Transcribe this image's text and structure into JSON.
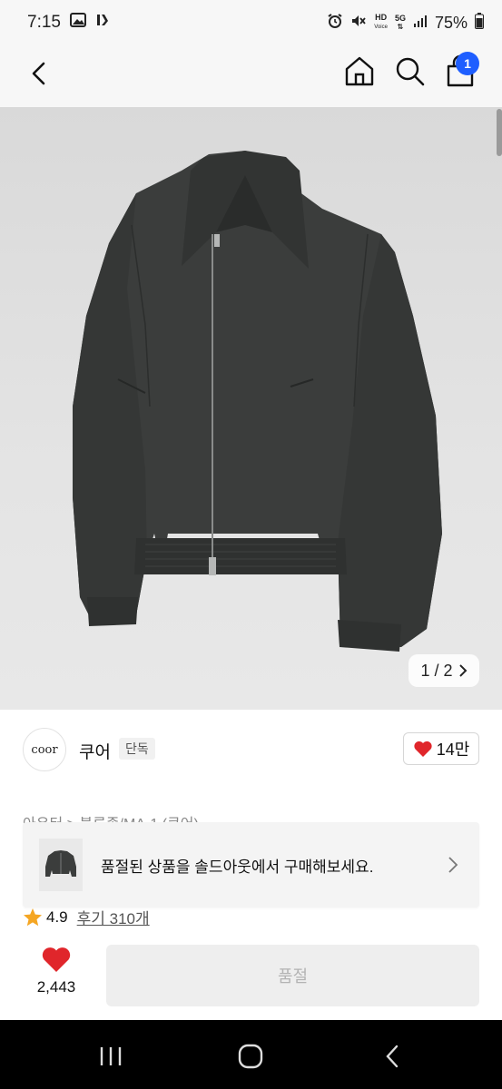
{
  "status_bar": {
    "time": "7:15",
    "battery": "75%",
    "network_top": "HD",
    "network_sub": "Voice",
    "gen": "5G"
  },
  "nav": {
    "cart_count": "1"
  },
  "gallery": {
    "counter": "1 / 2"
  },
  "brand": {
    "logo_text": "coor",
    "name": "쿠어",
    "badge": "단독",
    "likes": "14만"
  },
  "breadcrumb": "아우터 > 블루종/MA-1 (쿠어)",
  "soldout_banner": {
    "text": "품절된 상품을 솔드아웃에서 구매해보세요."
  },
  "rating": {
    "score": "4.9",
    "reviews": "후기 310개"
  },
  "action_bar": {
    "wish_count": "2,443",
    "button_label": "품절"
  },
  "colors": {
    "accent_badge": "#1e5eff",
    "heart": "#e0262b",
    "star": "#f5a623"
  }
}
